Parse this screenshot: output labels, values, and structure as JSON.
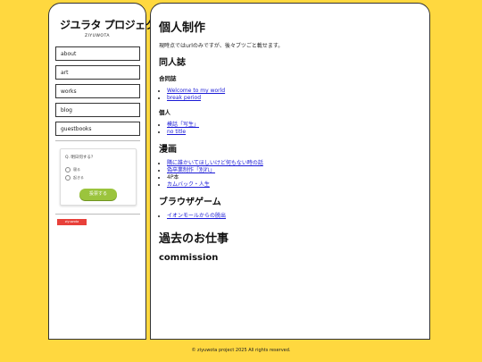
{
  "sidebar": {
    "logo": {
      "title": "ジユラタ プロジェクト",
      "subtitle": "ZIYUWOTA"
    },
    "nav": [
      {
        "label": "about"
      },
      {
        "label": "art"
      },
      {
        "label": "works"
      },
      {
        "label": "blog"
      },
      {
        "label": "guestbooks"
      }
    ],
    "poll": {
      "question": "Q. 明日何する？",
      "options": [
        "寝る",
        "起きる"
      ],
      "submit_label": "投票する"
    },
    "badge": "ziyuwota"
  },
  "main": {
    "title": "個人制作",
    "intro": "現時点ではurlのみですが、後々ブツごと載せます。",
    "doujinshi": {
      "heading": "同人誌",
      "group_heading": "合同誌",
      "group_items": [
        "Welcome to my world",
        "break period"
      ],
      "solo_heading": "個人",
      "solo_items": [
        "模話「写生」",
        "no title"
      ]
    },
    "manga": {
      "heading": "漫画",
      "items": [
        {
          "text": "隣に誰かいてほしいけど何もない時の話",
          "link": true
        },
        {
          "text": "偽卒業制作「別れ」",
          "link": true
        },
        {
          "text": "4P本",
          "link": false
        },
        {
          "text": "カムバック・人生",
          "link": true
        }
      ]
    },
    "browser_game": {
      "heading": "ブラウザゲーム",
      "items": [
        "イオンモールからの脱出"
      ]
    },
    "past_work_heading": "過去のお仕事",
    "commission_heading": "commission"
  },
  "footer": "© ziyuwota project 2025 All rights reserved."
}
